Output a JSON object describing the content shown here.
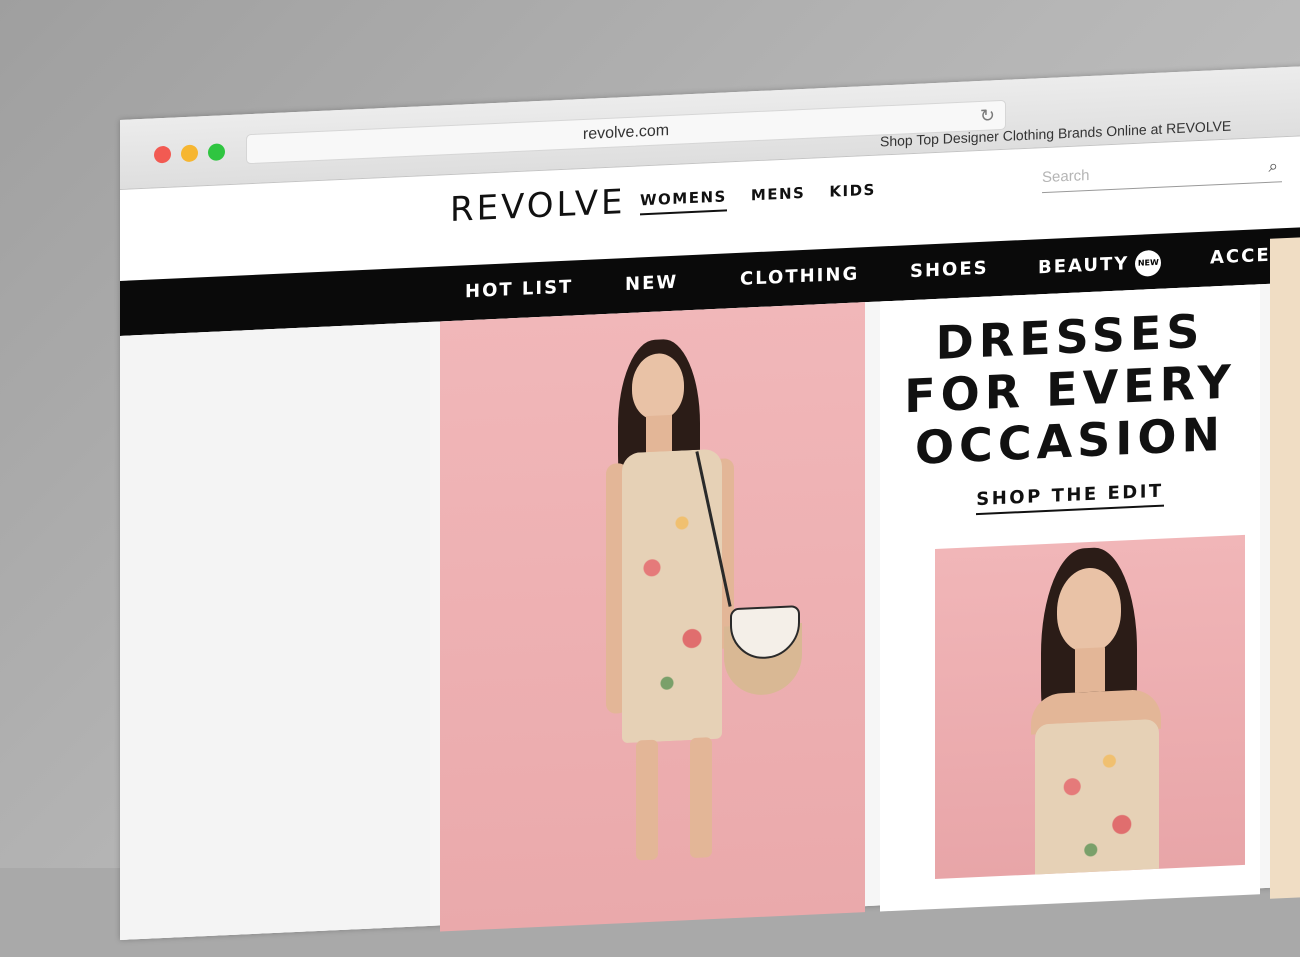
{
  "browser": {
    "url": "revolve.com",
    "tab_title": "Shop Top Designer Clothing Brands Online at REVOLVE",
    "traffic_lights": [
      "#f25a52",
      "#f6b631",
      "#2fc540"
    ]
  },
  "header": {
    "logo": "REVOLVE",
    "gender_nav": [
      "WOMENS",
      "MENS",
      "KIDS"
    ],
    "active_gender": "WOMENS",
    "search_placeholder": "Search"
  },
  "category_nav": {
    "items": [
      "HOT LIST",
      "NEW",
      "CLOTHING",
      "SHOES",
      "BEAUTY",
      "ACCESS"
    ],
    "beauty_badge": "NEW"
  },
  "promo": {
    "heading_lines": [
      "DRESSES",
      "FOR EVERY",
      "OCCASION"
    ],
    "cta": "SHOP THE EDIT"
  },
  "colors": {
    "nav_background": "#0a0a0a",
    "hero_pink": "#f1b7b9"
  }
}
